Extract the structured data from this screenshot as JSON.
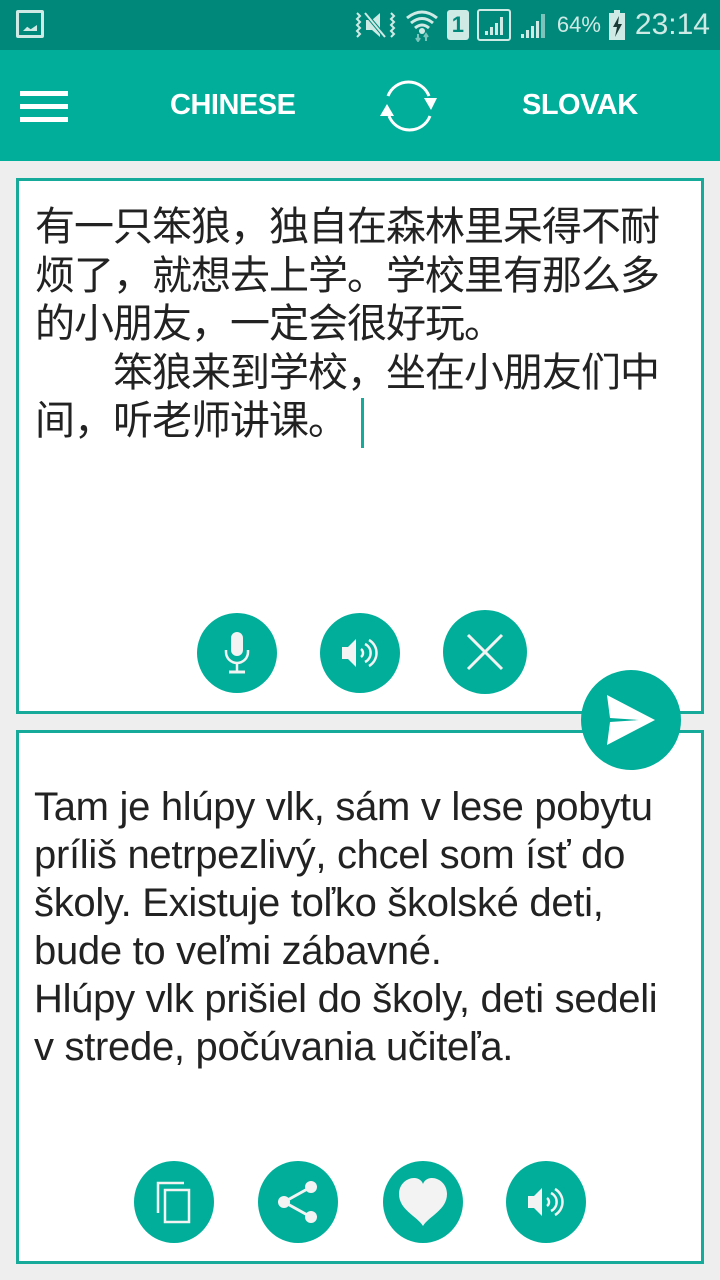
{
  "status_bar": {
    "notification_icon": "gallery-icon",
    "icons": [
      "mute-vibrate-icon",
      "wifi-icon",
      "sim-1-icon",
      "signal-icon",
      "signal-icon-2",
      "battery-charging-icon"
    ],
    "sim_label": "1",
    "battery": "64%",
    "time": "23:14"
  },
  "app_bar": {
    "menu_icon": "hamburger-menu-icon",
    "source_language": "CHINESE",
    "swap_icon": "swap-languages-icon",
    "target_language": "SLOVAK"
  },
  "source_panel": {
    "text": "有一只笨狼，独自在森林里呆得不耐烦了，就想去上学。学校里有那么多的小朋友，一定会很好玩。\n　　笨狼来到学校，坐在小朋友们中间，听老师讲课。",
    "buttons": [
      {
        "name": "microphone",
        "icon": "microphone-icon"
      },
      {
        "name": "speak-source",
        "icon": "speaker-icon"
      },
      {
        "name": "clear",
        "icon": "close-icon"
      }
    ]
  },
  "send_button": {
    "icon": "send-icon"
  },
  "target_panel": {
    "text": "Tam je hlúpy vlk, sám v lese pobytu príliš netrpezlivý, chcel som ísť do školy. Existuje toľko školské deti, bude to veľmi zábavné.\nHlúpy vlk prišiel do školy, deti sedeli v strede, počúvania učiteľa.",
    "buttons": [
      {
        "name": "copy",
        "icon": "copy-icon"
      },
      {
        "name": "share",
        "icon": "share-icon"
      },
      {
        "name": "favorite",
        "icon": "heart-icon"
      },
      {
        "name": "speak-target",
        "icon": "speaker-icon"
      }
    ]
  },
  "colors": {
    "status_bar": "#00897b",
    "accent": "#00ae9a",
    "panel_border": "#15aa9a",
    "background": "#eeeeee",
    "text": "#222222"
  }
}
